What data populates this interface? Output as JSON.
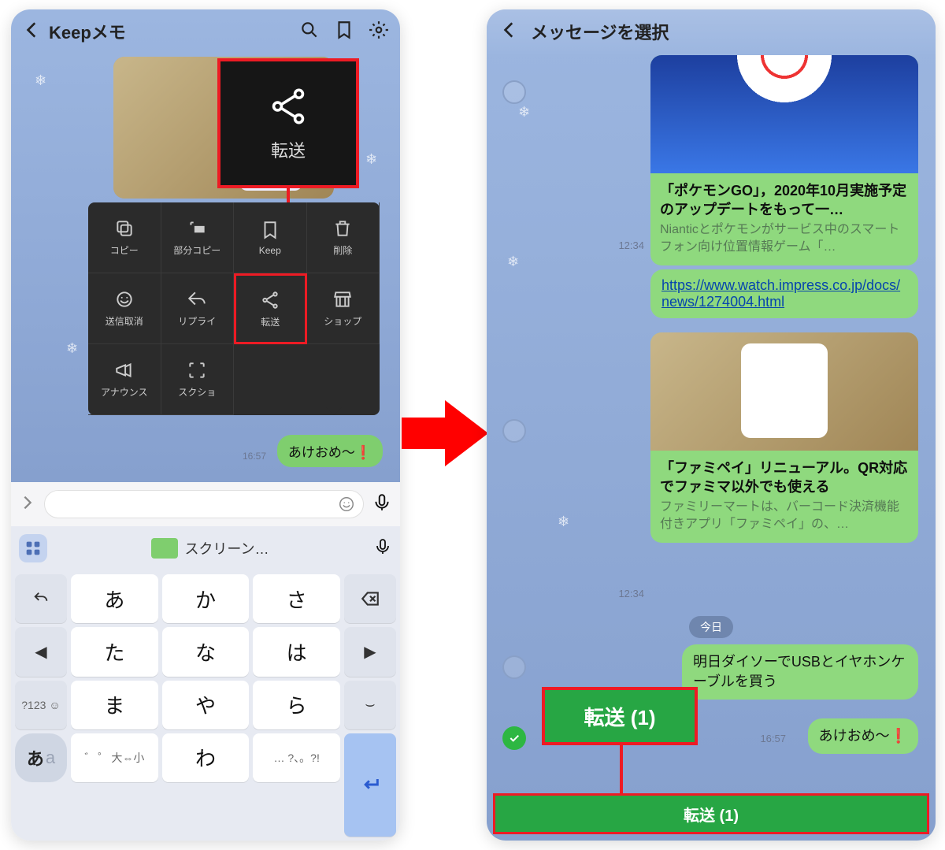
{
  "left": {
    "title": "Keepメモ",
    "callout_forward": "転送",
    "menu": [
      "コピー",
      "部分コピー",
      "Keep",
      "削除",
      "送信取消",
      "リプライ",
      "転送",
      "ショップ",
      "アナウンス",
      "スクショ"
    ],
    "bubble_ake": "あけおめ〜❗",
    "time_ake": "16:57",
    "kb_suggestion": "スクリーン…",
    "kana": {
      "r1": [
        "あ",
        "か",
        "さ"
      ],
      "r2": [
        "た",
        "な",
        "は"
      ],
      "r3": [
        "ま",
        "や",
        "ら"
      ],
      "r4": [
        "。?!",
        "わ",
        "、。?!"
      ]
    },
    "sym_key": "?123",
    "size_key": "大⇔小",
    "lang_jp": "あ",
    "lang_en": "a",
    "underbar": "⌣",
    "arrow_ret": "↩"
  },
  "right": {
    "title": "メッセージを選択",
    "card1_title": "「ポケモンGO」，2020年10月実施予定のアップデートをもって一…",
    "card1_desc": "Nianticとポケモンがサービス中のスマートフォン向け位置情報ゲーム「…",
    "time1": "12:34",
    "link": "https://www.watch.impress.co.jp/docs/news/1274004.html",
    "card2_title": "「ファミペイ」リニューアル。QR対応でファミマ以外でも使える",
    "card2_desc": "ファミリーマートは、バーコード決済機能付きアプリ「ファミペイ」の、…",
    "time2": "12:34",
    "date_chip": "今日",
    "msg_usb": "明日ダイソーでUSBとイヤホンケーブルを買う",
    "bubble_ake": "あけおめ〜❗",
    "time_ake": "16:57",
    "forward_count_callout": "転送 (1)",
    "forward_button": "転送 (1)"
  }
}
